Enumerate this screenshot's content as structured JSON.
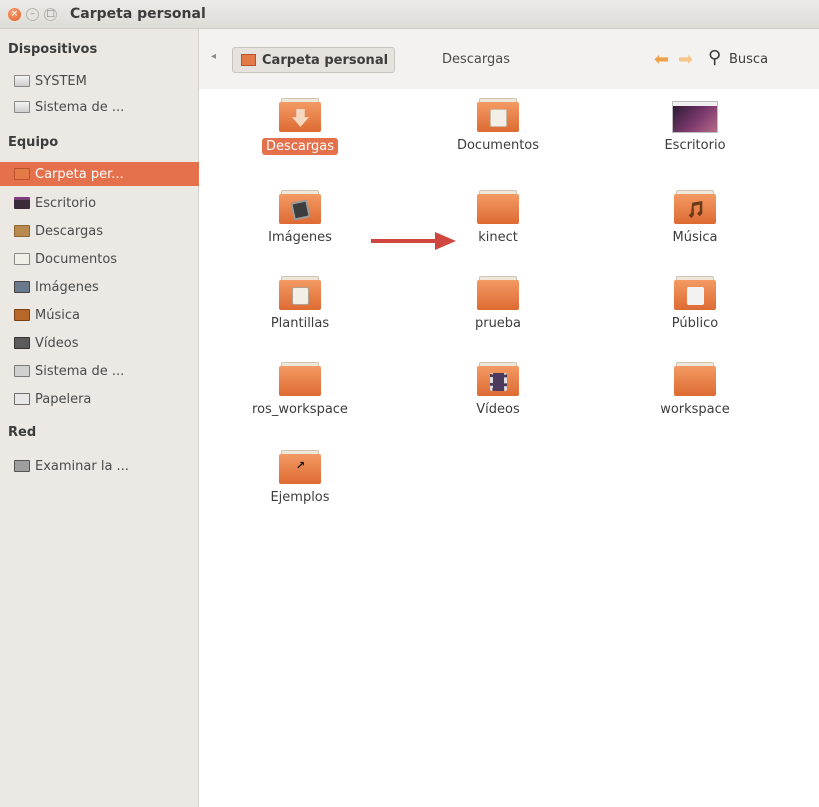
{
  "window": {
    "title": "Carpeta personal",
    "buttons": [
      "close",
      "minimize",
      "maximize"
    ]
  },
  "sidebar": {
    "sections": [
      {
        "heading": "Dispositivos",
        "items": [
          {
            "label": "SYSTEM",
            "icon": "drive-icon"
          },
          {
            "label": "Sistema de ...",
            "icon": "drive-icon"
          }
        ]
      },
      {
        "heading": "Equipo",
        "items": [
          {
            "label": "Carpeta per...",
            "icon": "home-folder-icon",
            "selected": true
          },
          {
            "label": "Escritorio",
            "icon": "desktop-icon"
          },
          {
            "label": "Descargas",
            "icon": "downloads-icon"
          },
          {
            "label": "Documentos",
            "icon": "documents-icon"
          },
          {
            "label": "Imágenes",
            "icon": "pictures-icon"
          },
          {
            "label": "Música",
            "icon": "music-icon"
          },
          {
            "label": "Vídeos",
            "icon": "videos-icon"
          },
          {
            "label": "Sistema de ...",
            "icon": "filesystem-icon"
          },
          {
            "label": "Papelera",
            "icon": "trash-icon"
          }
        ]
      },
      {
        "heading": "Red",
        "items": [
          {
            "label": "Examinar la ...",
            "icon": "network-icon"
          }
        ]
      }
    ]
  },
  "toolbar": {
    "path_active": "Carpeta personal",
    "path_next": "Descargas",
    "search_label": "Busca",
    "back_icon": "back-arrow-icon",
    "forward_icon": "forward-arrow-icon"
  },
  "files": [
    {
      "label": "Descargas",
      "icon": "downloads-folder",
      "selected": true
    },
    {
      "label": "Documentos",
      "icon": "documents-folder"
    },
    {
      "label": "Escritorio",
      "icon": "desktop-folder"
    },
    {
      "label": "Imágenes",
      "icon": "pictures-folder"
    },
    {
      "label": "kinect",
      "icon": "folder"
    },
    {
      "label": "Música",
      "icon": "music-folder"
    },
    {
      "label": "Plantillas",
      "icon": "templates-folder"
    },
    {
      "label": "prueba",
      "icon": "folder"
    },
    {
      "label": "Público",
      "icon": "public-folder"
    },
    {
      "label": "ros_workspace",
      "icon": "folder"
    },
    {
      "label": "Vídeos",
      "icon": "videos-folder"
    },
    {
      "label": "workspace",
      "icon": "folder"
    },
    {
      "label": "Ejemplos",
      "icon": "examples-link-folder"
    }
  ],
  "annotation": {
    "arrow_color": "#d0473f",
    "points_to": "kinect"
  },
  "colors": {
    "accent": "#e4714c",
    "sidebar_bg": "#ece9e4",
    "folder_orange": "#e8743c"
  }
}
